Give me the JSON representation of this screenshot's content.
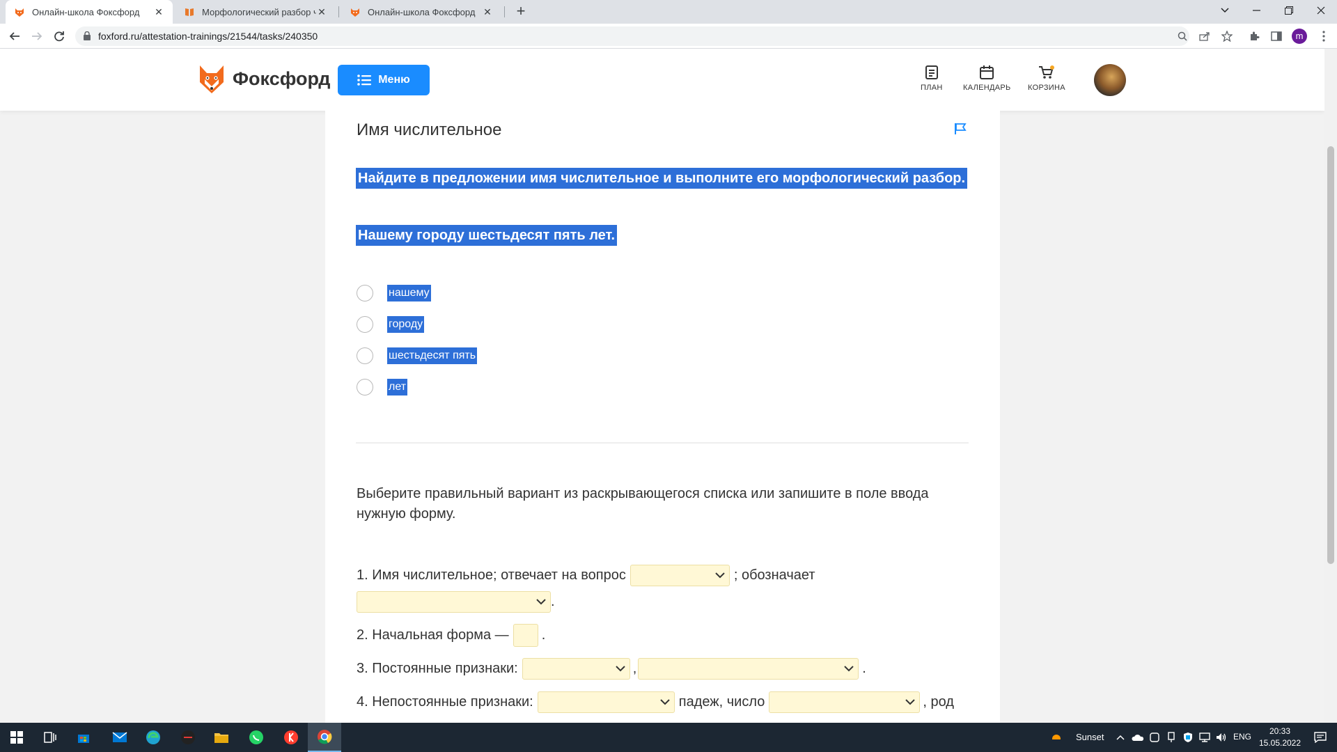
{
  "browser": {
    "tabs": [
      {
        "title": "Онлайн-школа Фоксфорд",
        "active": true
      },
      {
        "title": "Морфологический разбор числ",
        "active": false
      },
      {
        "title": "Онлайн-школа Фоксфорд",
        "active": false
      }
    ],
    "url": "foxford.ru/attestation-trainings/21544/tasks/240350",
    "profile_initial": "m"
  },
  "header": {
    "logo_text": "Фоксфорд",
    "menu_label": "Меню",
    "nav": [
      {
        "label": "ПЛАН",
        "icon": "plan-icon"
      },
      {
        "label": "КАЛЕНДАРЬ",
        "icon": "calendar-icon"
      },
      {
        "label": "КОРЗИНА",
        "icon": "cart-icon"
      }
    ]
  },
  "task": {
    "title": "Имя числительное",
    "instruction": "Найдите в предложении имя числительное и выполните его морфологический разбор.",
    "sentence": "Нашему городу шестьдесят пять лет.",
    "options": [
      "нашему",
      "городу",
      "шестьдесят пять",
      "лет"
    ],
    "prompt": "Выберите правильный вариант из раскрывающегося списка или запишите в поле ввода нужную форму.",
    "lines": {
      "l1_a": "1. Имя числительное; отвечает на вопрос",
      "l1_b": "; обозначает",
      "l1_end": ".",
      "l2_a": "2. Начальная форма —",
      "l2_end": ".",
      "l3_a": "3. Постоянные признаки:",
      "l3_comma": ",",
      "l3_end": ".",
      "l4_a": "4. Непостоянные признаки:",
      "l4_b": "падеж, число",
      "l4_c": ", род"
    }
  },
  "taskbar": {
    "weather": "Sunset",
    "lang": "ENG",
    "time": "20:33",
    "date": "15.05.2022"
  },
  "colors": {
    "accent": "#1a8cff",
    "selection": "#2d6fd8",
    "input_bg": "#fff8d6"
  }
}
